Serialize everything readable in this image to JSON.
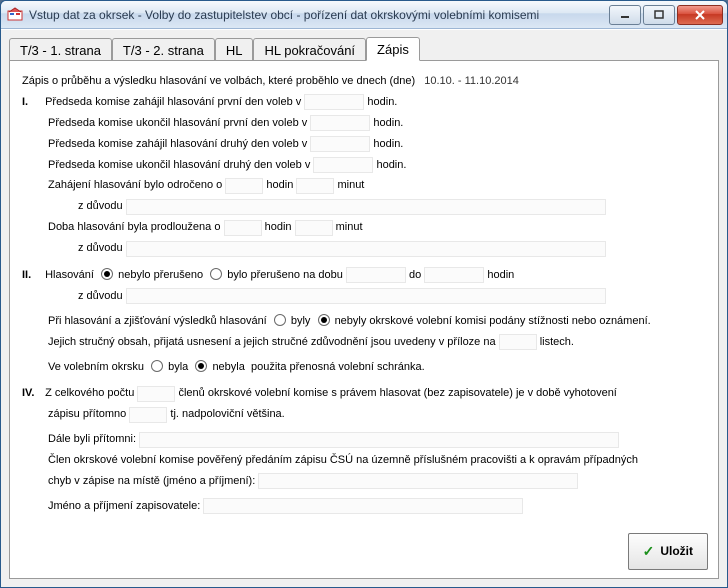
{
  "window": {
    "title": "Vstup dat za okrsek - Volby do zastupitelstev obcí - pořízení dat okrskovými volebními komisemi"
  },
  "tabs": {
    "t1": "T/3 - 1. strana",
    "t2": "T/3 - 2. strana",
    "t3": "HL",
    "t4": "HL pokračování",
    "t5": "Zápis"
  },
  "zapis": {
    "intro": "Zápis o průběhu a výsledku hlasování ve volbách, které proběhlo ve dnech (dne)",
    "dates": "10.10. - 11.10.2014",
    "s1_label": "I.",
    "s1_l1_a": "Předseda komise zahájil hlasování první den voleb v",
    "s1_l1_b": "hodin.",
    "s1_l2_a": "Předseda komise ukončil hlasování první den voleb v",
    "s1_l2_b": "hodin.",
    "s1_l3_a": "Předseda komise zahájil hlasování druhý den voleb v",
    "s1_l3_b": "hodin.",
    "s1_l4_a": "Předseda komise ukončil hlasování druhý den voleb v",
    "s1_l4_b": "hodin.",
    "s1_l5_a": "Zahájení hlasování bylo odročeno o",
    "s1_l5_b": "hodin",
    "s1_l5_c": "minut",
    "s1_reason": "z důvodu",
    "s1_l6_a": "Doba hlasování byla prodloužena o",
    "s1_l6_b": "hodin",
    "s1_l6_c": "minut",
    "s2_label": "II.",
    "s2_l1_a": "Hlasování",
    "s2_r1": "nebylo přerušeno",
    "s2_r2": "bylo přerušeno na dobu",
    "s2_l1_b": "do",
    "s2_l1_c": "hodin",
    "s2_l2_a": "Při hlasování a zjišťování výsledků hlasování",
    "s2_r3": "byly",
    "s2_r4": "nebyly",
    "s2_l2_b": "okrskové volební komisi podány stížnosti nebo oznámení.",
    "s2_l3_a": "Jejich stručný obsah, přijatá usnesení a jejich stručné zdůvodnění jsou uvedeny v příloze na",
    "s2_l3_b": "listech.",
    "s2_l4_a": "Ve volebním okrsku",
    "s2_r5": "byla",
    "s2_r6": "nebyla",
    "s2_l4_b": "použita přenosná volební schránka.",
    "s4_label": "IV.",
    "s4_l1_a": "Z celkového počtu",
    "s4_l1_b": "členů okrskové volební komise s právem hlasovat (bez zapisovatele) je v době vyhotovení",
    "s4_l2_a": "zápisu přítomno",
    "s4_l2_b": "tj. nadpoloviční většina.",
    "s4_l3": "Dále byli přítomni:",
    "s4_l4_a": "Člen okrskové volební komise pověřený předáním zápisu ČSÚ na územně příslušném pracovišti a k opravám případných",
    "s4_l4_b": "chyb v zápise na místě (jméno a příjmení):",
    "s4_l5": "Jméno a příjmení zapisovatele:",
    "save": "Uložit"
  }
}
